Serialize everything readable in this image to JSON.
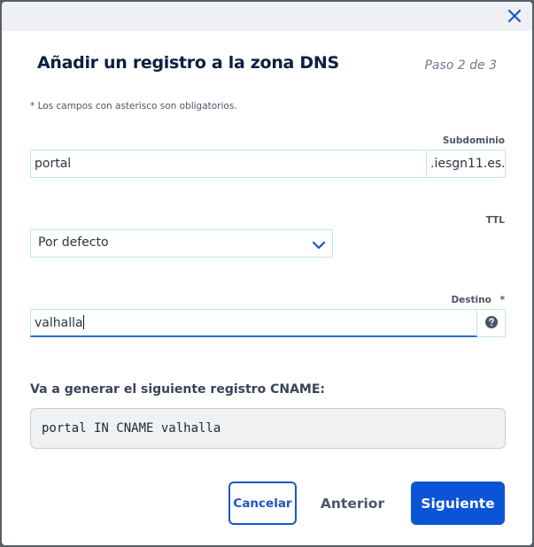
{
  "dialog": {
    "title": "Añadir un registro a la zona DNS",
    "step": "Paso 2 de 3",
    "required_note": "* Los campos con asterisco son obligatorios."
  },
  "subdomain": {
    "label": "Subdominio",
    "value": "portal",
    "suffix": ".iesgn11.es."
  },
  "ttl": {
    "label": "TTL",
    "selected": "Por defecto"
  },
  "target": {
    "label": "Destino",
    "required_mark": "*",
    "value": "valhalla"
  },
  "preview": {
    "label": "Va a generar el siguiente registro CNAME:",
    "record": "portal IN CNAME valhalla"
  },
  "buttons": {
    "cancel": "Cancelar",
    "previous": "Anterior",
    "next": "Siguiente"
  },
  "colors": {
    "primary": "#0c54d6",
    "title": "#0b1f3f",
    "field_border": "#bfe6ee"
  },
  "icons": {
    "close": "close-icon",
    "dropdown": "chevron-down-icon",
    "help": "question-circle-icon"
  }
}
